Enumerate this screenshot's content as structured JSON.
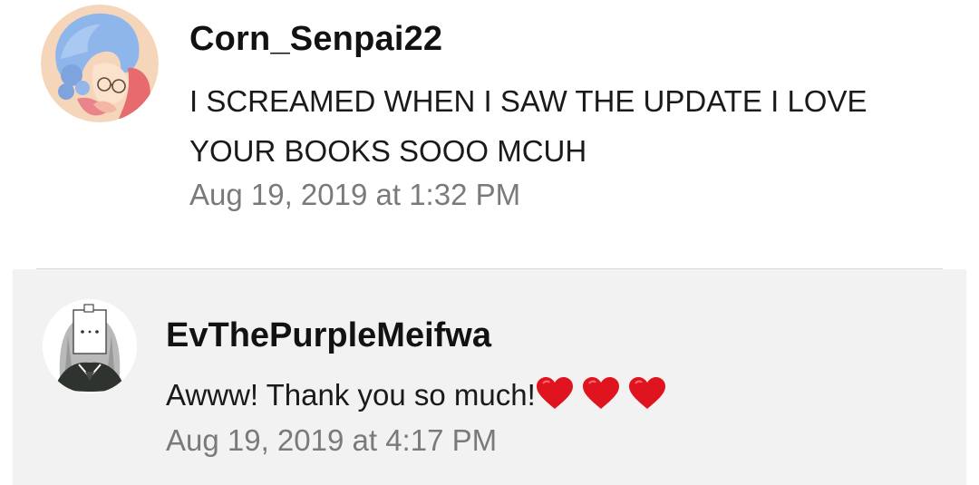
{
  "comment": {
    "username": "Corn_Senpai22",
    "body": "I SCREAMED WHEN I SAW THE UPDATE I LOVE YOUR BOOKS SOOO MCUH",
    "timestamp": "Aug 19, 2019 at 1:32 PM",
    "avatar_icon": "anime-character-avatar-icon"
  },
  "reply": {
    "username": "EvThePurpleMeifwa",
    "body": "Awww! Thank you so much!",
    "emoji": [
      "red-heart-icon",
      "red-heart-icon",
      "red-heart-icon"
    ],
    "timestamp": "Aug 19, 2019 at 4:17 PM",
    "avatar_icon": "anime-character-avatar-icon"
  },
  "colors": {
    "reply_background": "#f2f2f2",
    "timestamp_text": "#7a7a7a",
    "heart": "#e0141e"
  }
}
